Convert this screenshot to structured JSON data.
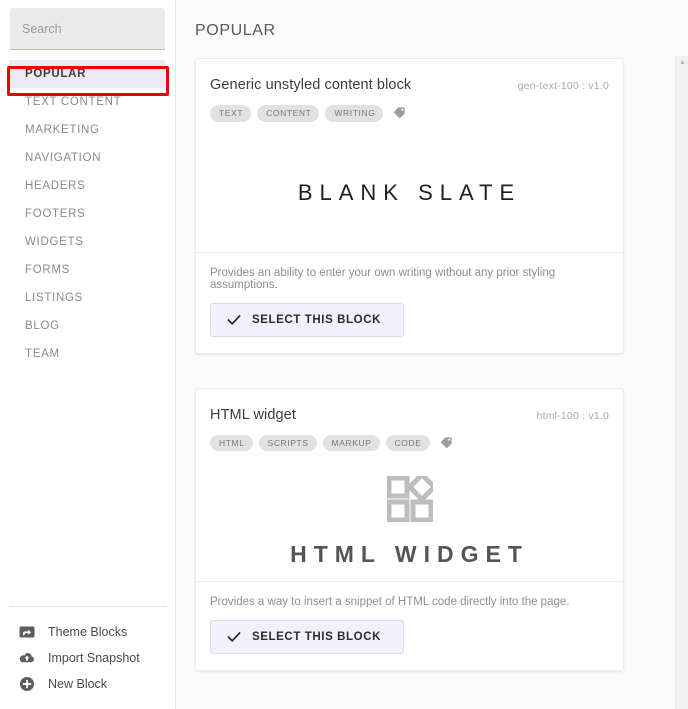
{
  "sidebar": {
    "search": {
      "placeholder": "Search",
      "value": ""
    },
    "nav_items": [
      {
        "label": "POPULAR",
        "active": true
      },
      {
        "label": "TEXT CONTENT",
        "active": false
      },
      {
        "label": "MARKETING",
        "active": false
      },
      {
        "label": "NAVIGATION",
        "active": false
      },
      {
        "label": "HEADERS",
        "active": false
      },
      {
        "label": "FOOTERS",
        "active": false
      },
      {
        "label": "WIDGETS",
        "active": false
      },
      {
        "label": "FORMS",
        "active": false
      },
      {
        "label": "LISTINGS",
        "active": false
      },
      {
        "label": "BLOG",
        "active": false
      },
      {
        "label": "TEAM",
        "active": false
      }
    ],
    "footer_items": [
      {
        "label": "Theme Blocks",
        "icon": "theme-blocks-icon"
      },
      {
        "label": "Import Snapshot",
        "icon": "cloud-upload-icon"
      },
      {
        "label": "New Block",
        "icon": "plus-circle-icon"
      }
    ]
  },
  "main": {
    "title": "POPULAR",
    "cards": [
      {
        "title": "Generic unstyled content block",
        "meta": "gen-text-100 : v1.0",
        "tags": [
          "TEXT",
          "CONTENT",
          "WRITING"
        ],
        "tag_icon": "tag-icon",
        "preview_kind": "text",
        "preview_text": "BLANK SLATE",
        "description": "Provides an ability to enter your own writing without any prior styling assumptions.",
        "button_label": "SELECT THIS BLOCK",
        "button_icon": "check-icon"
      },
      {
        "title": "HTML widget",
        "meta": "html-100 : v1.0",
        "tags": [
          "HTML",
          "SCRIPTS",
          "MARKUP",
          "CODE"
        ],
        "tag_icon": "tag-icon",
        "preview_kind": "widget",
        "preview_icon": "widgets-grid-icon",
        "preview_text": "HTML WIDGET",
        "description": "Provides a way to insert a snippet of HTML code directly into the page.",
        "button_label": "SELECT THIS BLOCK",
        "button_icon": "check-icon"
      }
    ]
  },
  "scrollbar": {
    "arrow_glyph": "▲"
  },
  "annotation": {
    "target": "POPULAR",
    "color": "#ee0000"
  },
  "colors": {
    "accent": "#eceaf6",
    "button_bg": "#f2f1fb",
    "tag_bg": "#e1e1e1",
    "annotation_red": "#ee0000",
    "main_bg": "#fafafa"
  }
}
